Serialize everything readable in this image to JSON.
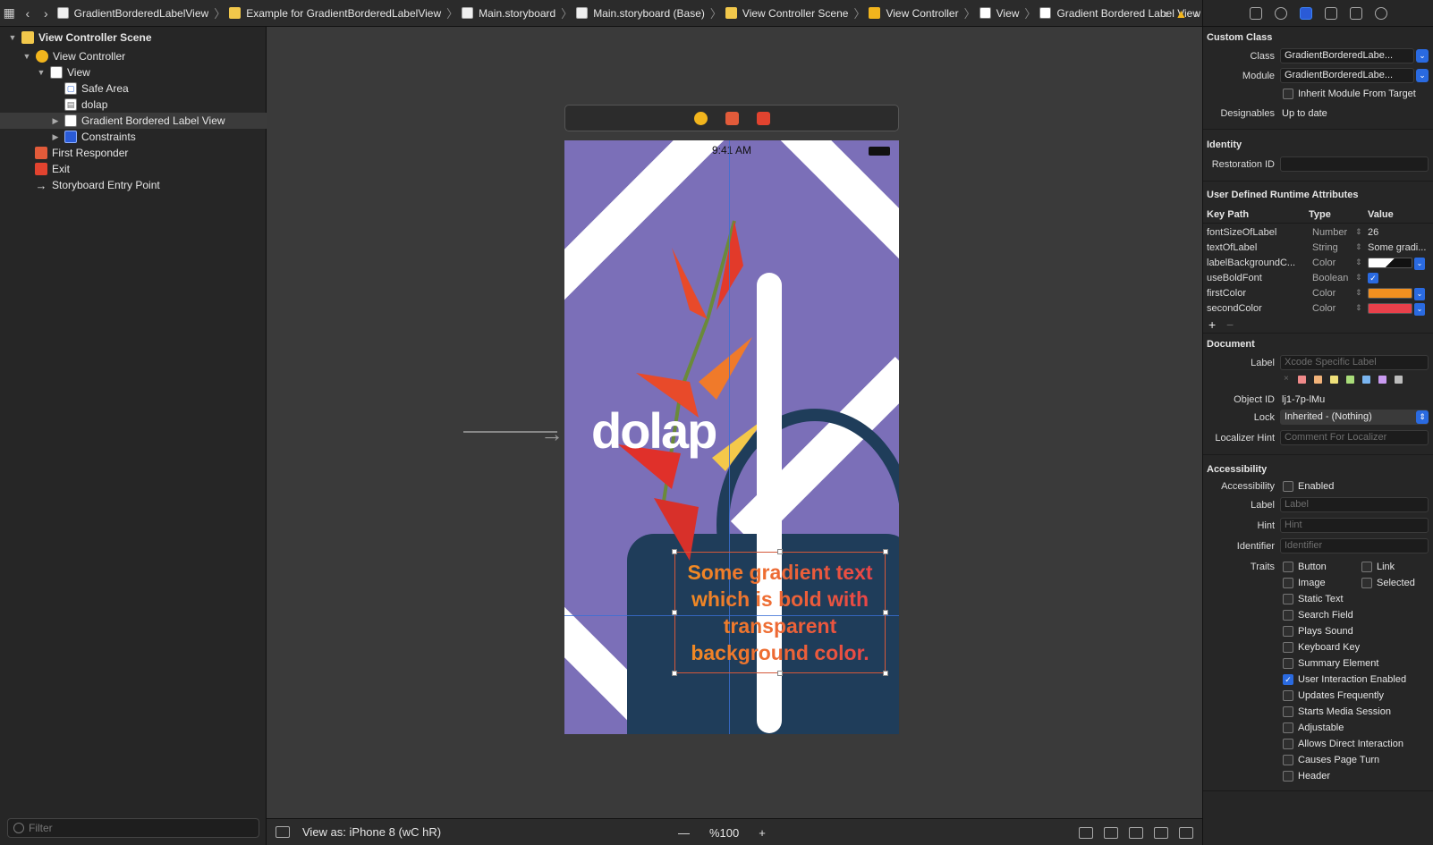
{
  "jumpbar": {
    "crumbs": [
      {
        "label": "GradientBorderedLabelView",
        "icon": "file-icon"
      },
      {
        "label": "Example for GradientBorderedLabelView",
        "icon": "folder-icon"
      },
      {
        "label": "Main.storyboard",
        "icon": "storyboard-icon"
      },
      {
        "label": "Main.storyboard (Base)",
        "icon": "storyboard-icon"
      },
      {
        "label": "View Controller Scene",
        "icon": "scene-icon"
      },
      {
        "label": "View Controller",
        "icon": "view-controller-icon"
      },
      {
        "label": "View",
        "icon": "view-icon"
      },
      {
        "label": "Gradient Bordered Label View",
        "icon": "view-icon"
      }
    ]
  },
  "navigator": {
    "items": [
      {
        "label": "View Controller Scene",
        "bold": true
      },
      {
        "label": "View Controller"
      },
      {
        "label": "View"
      },
      {
        "label": "Safe Area"
      },
      {
        "label": "dolap"
      },
      {
        "label": "Gradient Bordered Label View"
      },
      {
        "label": "Constraints"
      },
      {
        "label": "First Responder"
      },
      {
        "label": "Exit"
      },
      {
        "label": "Storyboard Entry Point"
      }
    ],
    "filter_placeholder": "Filter"
  },
  "canvas": {
    "status_time": "9:41 AM",
    "logo_text": "dolap",
    "gradient_text": "Some gradient text which is bold with transparent background color.",
    "gradient_start": "#f29020",
    "gradient_end": "#e8404a",
    "background_color": "#7b6fb8"
  },
  "bottombar": {
    "view_as": "View as: iPhone 8 (wC hR)",
    "zoom_minus": "—",
    "zoom": "%100",
    "zoom_plus": "+"
  },
  "inspector": {
    "custom_class": {
      "title": "Custom Class",
      "class_label": "Class",
      "class_value": "GradientBorderedLabe...",
      "module_label": "Module",
      "module_value": "GradientBorderedLabe...",
      "inherit_label": "Inherit Module From Target",
      "designables_label": "Designables",
      "designables_value": "Up to date"
    },
    "identity": {
      "title": "Identity",
      "restoration_label": "Restoration ID"
    },
    "udra": {
      "title": "User Defined Runtime Attributes",
      "headers": [
        "Key Path",
        "Type",
        "Value"
      ],
      "rows": [
        {
          "key": "fontSizeOfLabel",
          "type": "Number",
          "value": "26"
        },
        {
          "key": "textOfLabel",
          "type": "String",
          "value": "Some gradi..."
        },
        {
          "key": "labelBackgroundC...",
          "type": "Color",
          "value": ""
        },
        {
          "key": "useBoldFont",
          "type": "Boolean",
          "value": ""
        },
        {
          "key": "firstColor",
          "type": "Color",
          "value": "",
          "color": "#f29020"
        },
        {
          "key": "secondColor",
          "type": "Color",
          "value": "",
          "color": "#e8404a"
        }
      ]
    },
    "document": {
      "title": "Document",
      "label_label": "Label",
      "label_placeholder": "Xcode Specific Label",
      "object_id_label": "Object ID",
      "object_id_value": "lj1-7p-lMu",
      "lock_label": "Lock",
      "lock_value": "Inherited - (Nothing)",
      "localizer_label": "Localizer Hint",
      "localizer_placeholder": "Comment For Localizer",
      "swatches": [
        "#f08a8a",
        "#f2b37a",
        "#efe07a",
        "#a9dd7a",
        "#7ab5f0",
        "#c99af0",
        "#bdbdbd"
      ]
    },
    "accessibility": {
      "title": "Accessibility",
      "accessibility_label": "Accessibility",
      "enabled_label": "Enabled",
      "label_label": "Label",
      "label_placeholder": "Label",
      "hint_label": "Hint",
      "hint_placeholder": "Hint",
      "identifier_label": "Identifier",
      "identifier_placeholder": "Identifier",
      "traits_label": "Traits",
      "traits": [
        {
          "label": "Button",
          "checked": false
        },
        {
          "label": "Link",
          "checked": false
        },
        {
          "label": "Image",
          "checked": false
        },
        {
          "label": "Selected",
          "checked": false
        },
        {
          "label": "Static Text",
          "checked": false
        },
        {
          "label": "Search Field",
          "checked": false
        },
        {
          "label": "Plays Sound",
          "checked": false
        },
        {
          "label": "Keyboard Key",
          "checked": false
        },
        {
          "label": "Summary Element",
          "checked": false
        },
        {
          "label": "User Interaction Enabled",
          "checked": true
        },
        {
          "label": "Updates Frequently",
          "checked": false
        },
        {
          "label": "Starts Media Session",
          "checked": false
        },
        {
          "label": "Adjustable",
          "checked": false
        },
        {
          "label": "Allows Direct Interaction",
          "checked": false
        },
        {
          "label": "Causes Page Turn",
          "checked": false
        },
        {
          "label": "Header",
          "checked": false
        }
      ]
    }
  }
}
